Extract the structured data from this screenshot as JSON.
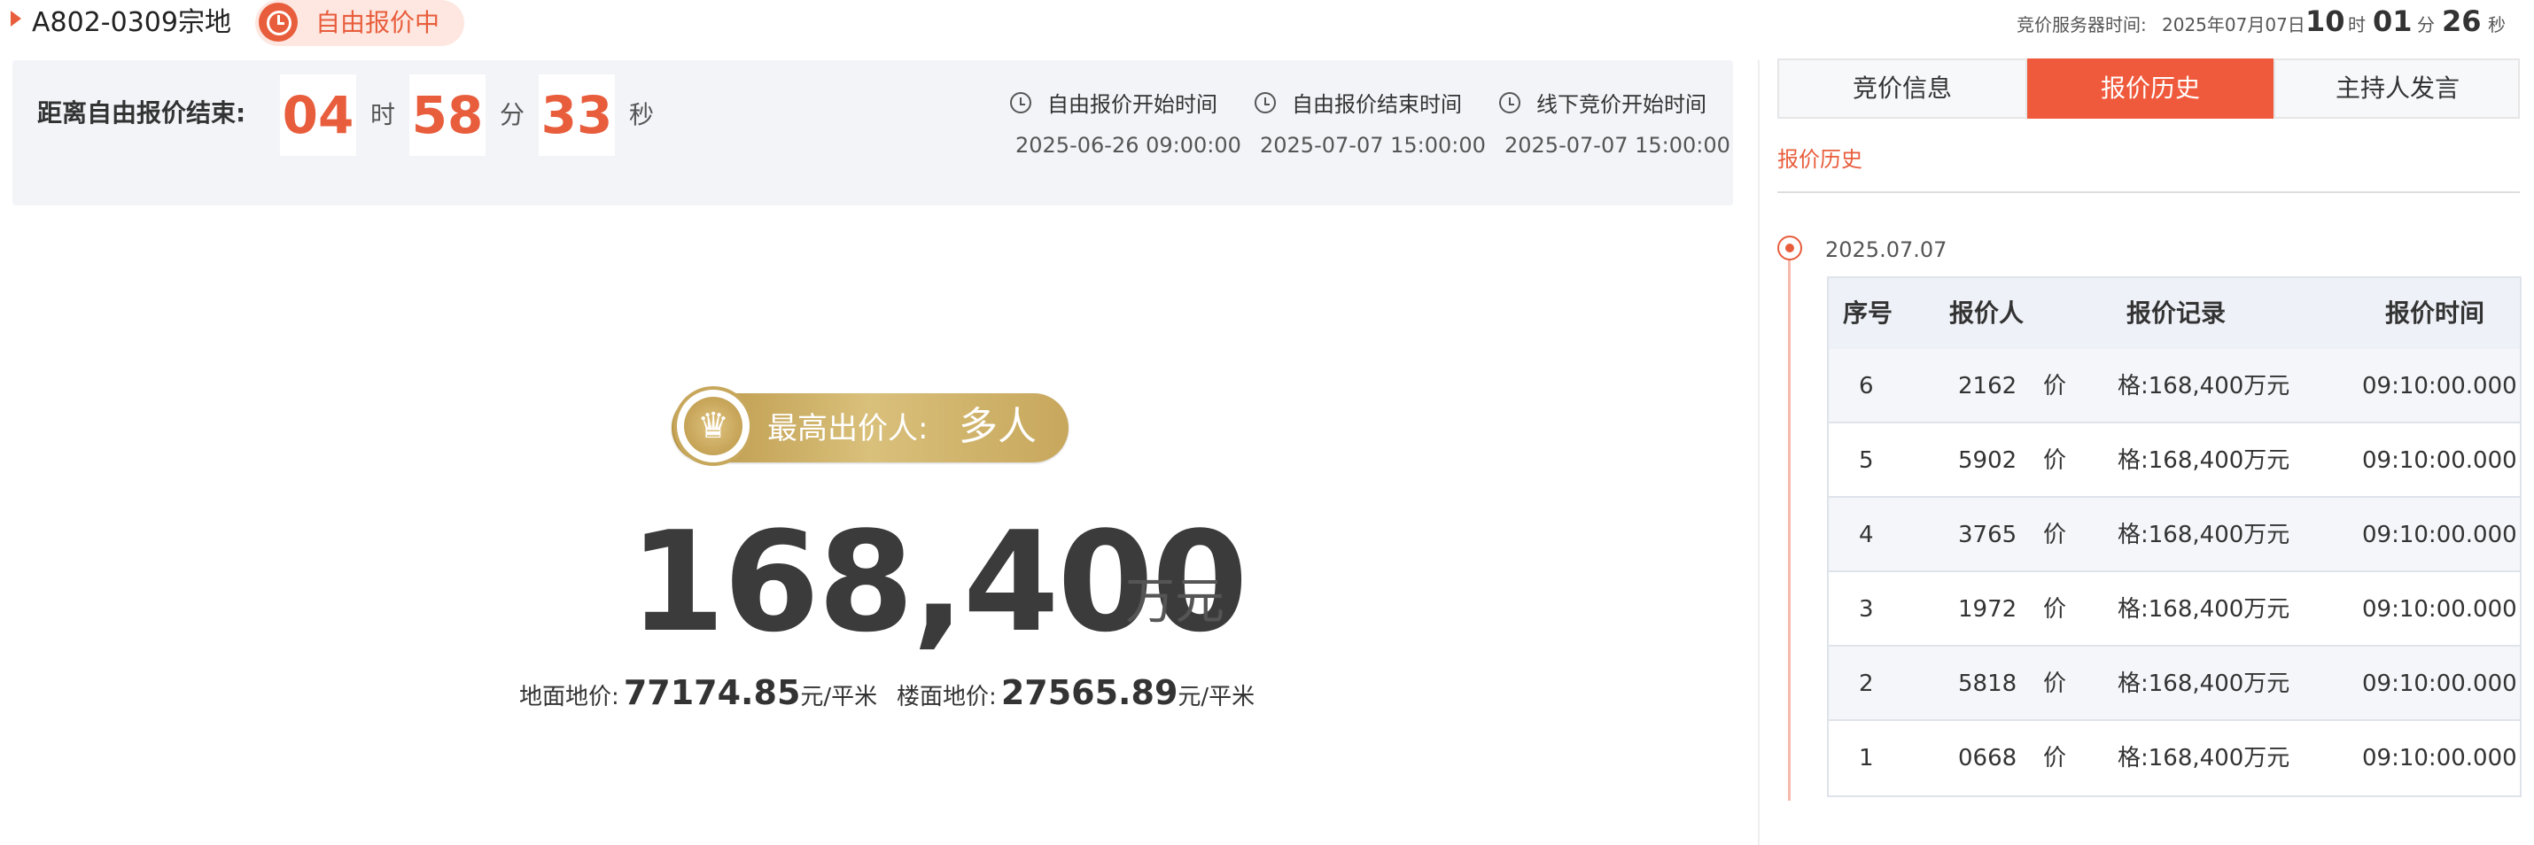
{
  "header": {
    "title": "A802-0309宗地",
    "status": "自由报价中",
    "server_label": "竞价服务器时间:",
    "server_date": "2025年07月07日",
    "server_hour": "10",
    "server_hour_unit": "时",
    "server_minute": "01",
    "server_minute_unit": "分",
    "server_second": "26",
    "server_second_unit": "秒"
  },
  "countdown": {
    "label": "距离自由报价结束:",
    "hours": "04",
    "hours_unit": "时",
    "minutes": "58",
    "minutes_unit": "分",
    "seconds": "33",
    "seconds_unit": "秒"
  },
  "times": [
    {
      "title": "自由报价开始时间",
      "value": "2025-06-26 09:00:00"
    },
    {
      "title": "自由报价结束时间",
      "value": "2025-07-07 15:00:00"
    },
    {
      "title": "线下竞价开始时间",
      "value": "2025-07-07 15:00:00"
    }
  ],
  "highest": {
    "label": "最高出价人:",
    "value": "多人"
  },
  "price": {
    "value": "168,400",
    "unit": "万元",
    "land_label": "地面地价:",
    "land_value": "77174.85",
    "land_unit": "元/平米",
    "floor_label": "楼面地价:",
    "floor_value": "27565.89",
    "floor_unit": "元/平米"
  },
  "tabs": [
    {
      "label": "竞价信息"
    },
    {
      "label": "报价历史"
    },
    {
      "label": "主持人发言"
    }
  ],
  "history": {
    "section_title": "报价历史",
    "date": "2025.07.07",
    "columns": [
      "序号",
      "报价人",
      "报价记录",
      "报价时间"
    ],
    "rows": [
      {
        "seq": "6",
        "bidder": "2162",
        "record_a": "价",
        "record_b": "格:168,400万元",
        "time": "09:10:00.000"
      },
      {
        "seq": "5",
        "bidder": "5902",
        "record_a": "价",
        "record_b": "格:168,400万元",
        "time": "09:10:00.000"
      },
      {
        "seq": "4",
        "bidder": "3765",
        "record_a": "价",
        "record_b": "格:168,400万元",
        "time": "09:10:00.000"
      },
      {
        "seq": "3",
        "bidder": "1972",
        "record_a": "价",
        "record_b": "格:168,400万元",
        "time": "09:10:00.000"
      },
      {
        "seq": "2",
        "bidder": "5818",
        "record_a": "价",
        "record_b": "格:168,400万元",
        "time": "09:10:00.000"
      },
      {
        "seq": "1",
        "bidder": "0668",
        "record_a": "价",
        "record_b": "格:168,400万元",
        "time": "09:10:00.000"
      }
    ]
  },
  "colors": {
    "accent": "#e85d3c",
    "gold": "#c7a75c",
    "panel_bg": "#f2f4f8"
  },
  "icons": [
    "clock-icon",
    "crown-icon",
    "caret-right-icon",
    "timeline-dot-icon"
  ]
}
